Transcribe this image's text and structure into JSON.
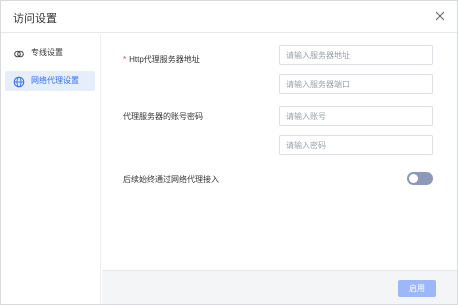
{
  "dialog": {
    "title": "访问设置"
  },
  "sidebar": {
    "items": [
      {
        "label": "专线设置",
        "icon": "link-icon",
        "active": false
      },
      {
        "label": "网络代理设置",
        "icon": "globe-icon",
        "active": true
      }
    ]
  },
  "form": {
    "http_proxy_label": "Http代理服务器地址",
    "required_mark": "*",
    "server_address_placeholder": "请输入服务器地址",
    "server_port_placeholder": "请输入服务器端口",
    "account_label": "代理服务器的账号密码",
    "account_placeholder": "请输入账号",
    "password_placeholder": "请输入密码",
    "always_proxy_label": "后续始终通过网络代理接入",
    "always_proxy_enabled": false
  },
  "footer": {
    "apply_label": "启用"
  },
  "colors": {
    "accent": "#2f6df6",
    "active_bg": "#e6eefc",
    "disabled_button": "#9db8f8",
    "toggle_off": "#8e99b7"
  }
}
